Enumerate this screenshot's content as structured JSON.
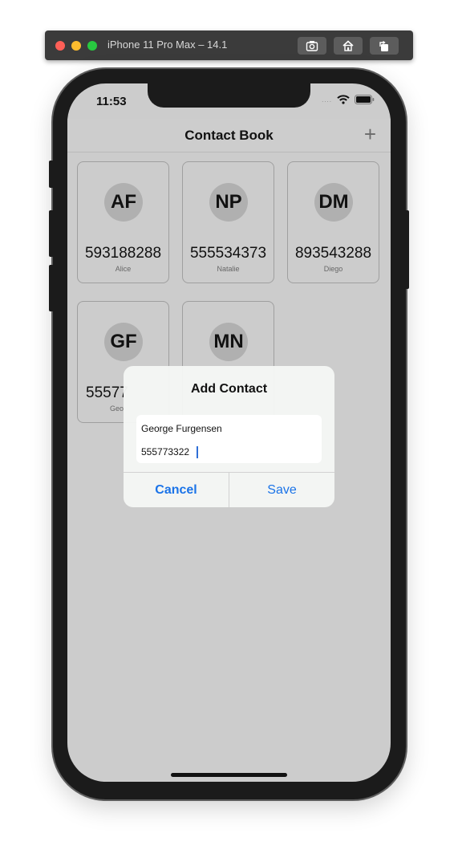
{
  "simulator": {
    "title": "iPhone 11 Pro Max – 14.1",
    "buttons": [
      "screenshot-icon",
      "home-icon",
      "rotate-icon"
    ]
  },
  "status_bar": {
    "time": "11:53",
    "signal": "....",
    "icons": [
      "wifi-icon",
      "battery-icon"
    ]
  },
  "nav": {
    "title": "Contact Book",
    "add_label": "+"
  },
  "contacts": [
    {
      "initials": "AF",
      "phone": "593188288",
      "name": "Alice"
    },
    {
      "initials": "NP",
      "phone": "555534373",
      "name": "Natalie"
    },
    {
      "initials": "DM",
      "phone": "893543288",
      "name": "Diego"
    },
    {
      "initials": "GF",
      "phone": "55577",
      "name": "Geo"
    },
    {
      "initials": "MN",
      "phone": "",
      "name": ""
    }
  ],
  "dialog": {
    "title": "Add Contact",
    "name_value": "George Furgensen",
    "phone_value": "555773322",
    "cancel_label": "Cancel",
    "save_label": "Save"
  },
  "colors": {
    "screen_bg": "#cccccc",
    "accent": "#1a73e8"
  }
}
